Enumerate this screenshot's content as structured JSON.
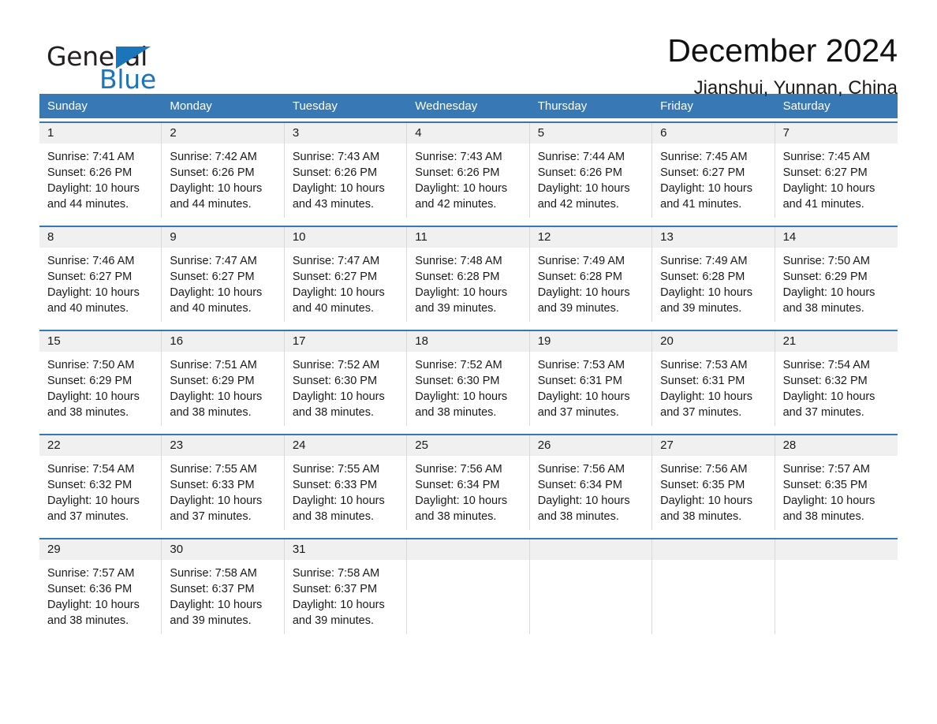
{
  "brand": {
    "word_one": "General",
    "word_two": "Blue",
    "triangle_icon": "triangle-icon",
    "accent_color": "#1b75bb"
  },
  "header": {
    "title": "December 2024",
    "location": "Jianshui, Yunnan, China"
  },
  "calendar": {
    "header_bg": "#3878b4",
    "row_rule_color": "#3878b4",
    "day_number_bg": "#f0f0f0",
    "weekdays": [
      "Sunday",
      "Monday",
      "Tuesday",
      "Wednesday",
      "Thursday",
      "Friday",
      "Saturday"
    ],
    "weeks": [
      [
        {
          "day": "1",
          "sunrise": "Sunrise: 7:41 AM",
          "sunset": "Sunset: 6:26 PM",
          "daylight_line1": "Daylight: 10 hours",
          "daylight_line2": "and 44 minutes."
        },
        {
          "day": "2",
          "sunrise": "Sunrise: 7:42 AM",
          "sunset": "Sunset: 6:26 PM",
          "daylight_line1": "Daylight: 10 hours",
          "daylight_line2": "and 44 minutes."
        },
        {
          "day": "3",
          "sunrise": "Sunrise: 7:43 AM",
          "sunset": "Sunset: 6:26 PM",
          "daylight_line1": "Daylight: 10 hours",
          "daylight_line2": "and 43 minutes."
        },
        {
          "day": "4",
          "sunrise": "Sunrise: 7:43 AM",
          "sunset": "Sunset: 6:26 PM",
          "daylight_line1": "Daylight: 10 hours",
          "daylight_line2": "and 42 minutes."
        },
        {
          "day": "5",
          "sunrise": "Sunrise: 7:44 AM",
          "sunset": "Sunset: 6:26 PM",
          "daylight_line1": "Daylight: 10 hours",
          "daylight_line2": "and 42 minutes."
        },
        {
          "day": "6",
          "sunrise": "Sunrise: 7:45 AM",
          "sunset": "Sunset: 6:27 PM",
          "daylight_line1": "Daylight: 10 hours",
          "daylight_line2": "and 41 minutes."
        },
        {
          "day": "7",
          "sunrise": "Sunrise: 7:45 AM",
          "sunset": "Sunset: 6:27 PM",
          "daylight_line1": "Daylight: 10 hours",
          "daylight_line2": "and 41 minutes."
        }
      ],
      [
        {
          "day": "8",
          "sunrise": "Sunrise: 7:46 AM",
          "sunset": "Sunset: 6:27 PM",
          "daylight_line1": "Daylight: 10 hours",
          "daylight_line2": "and 40 minutes."
        },
        {
          "day": "9",
          "sunrise": "Sunrise: 7:47 AM",
          "sunset": "Sunset: 6:27 PM",
          "daylight_line1": "Daylight: 10 hours",
          "daylight_line2": "and 40 minutes."
        },
        {
          "day": "10",
          "sunrise": "Sunrise: 7:47 AM",
          "sunset": "Sunset: 6:27 PM",
          "daylight_line1": "Daylight: 10 hours",
          "daylight_line2": "and 40 minutes."
        },
        {
          "day": "11",
          "sunrise": "Sunrise: 7:48 AM",
          "sunset": "Sunset: 6:28 PM",
          "daylight_line1": "Daylight: 10 hours",
          "daylight_line2": "and 39 minutes."
        },
        {
          "day": "12",
          "sunrise": "Sunrise: 7:49 AM",
          "sunset": "Sunset: 6:28 PM",
          "daylight_line1": "Daylight: 10 hours",
          "daylight_line2": "and 39 minutes."
        },
        {
          "day": "13",
          "sunrise": "Sunrise: 7:49 AM",
          "sunset": "Sunset: 6:28 PM",
          "daylight_line1": "Daylight: 10 hours",
          "daylight_line2": "and 39 minutes."
        },
        {
          "day": "14",
          "sunrise": "Sunrise: 7:50 AM",
          "sunset": "Sunset: 6:29 PM",
          "daylight_line1": "Daylight: 10 hours",
          "daylight_line2": "and 38 minutes."
        }
      ],
      [
        {
          "day": "15",
          "sunrise": "Sunrise: 7:50 AM",
          "sunset": "Sunset: 6:29 PM",
          "daylight_line1": "Daylight: 10 hours",
          "daylight_line2": "and 38 minutes."
        },
        {
          "day": "16",
          "sunrise": "Sunrise: 7:51 AM",
          "sunset": "Sunset: 6:29 PM",
          "daylight_line1": "Daylight: 10 hours",
          "daylight_line2": "and 38 minutes."
        },
        {
          "day": "17",
          "sunrise": "Sunrise: 7:52 AM",
          "sunset": "Sunset: 6:30 PM",
          "daylight_line1": "Daylight: 10 hours",
          "daylight_line2": "and 38 minutes."
        },
        {
          "day": "18",
          "sunrise": "Sunrise: 7:52 AM",
          "sunset": "Sunset: 6:30 PM",
          "daylight_line1": "Daylight: 10 hours",
          "daylight_line2": "and 38 minutes."
        },
        {
          "day": "19",
          "sunrise": "Sunrise: 7:53 AM",
          "sunset": "Sunset: 6:31 PM",
          "daylight_line1": "Daylight: 10 hours",
          "daylight_line2": "and 37 minutes."
        },
        {
          "day": "20",
          "sunrise": "Sunrise: 7:53 AM",
          "sunset": "Sunset: 6:31 PM",
          "daylight_line1": "Daylight: 10 hours",
          "daylight_line2": "and 37 minutes."
        },
        {
          "day": "21",
          "sunrise": "Sunrise: 7:54 AM",
          "sunset": "Sunset: 6:32 PM",
          "daylight_line1": "Daylight: 10 hours",
          "daylight_line2": "and 37 minutes."
        }
      ],
      [
        {
          "day": "22",
          "sunrise": "Sunrise: 7:54 AM",
          "sunset": "Sunset: 6:32 PM",
          "daylight_line1": "Daylight: 10 hours",
          "daylight_line2": "and 37 minutes."
        },
        {
          "day": "23",
          "sunrise": "Sunrise: 7:55 AM",
          "sunset": "Sunset: 6:33 PM",
          "daylight_line1": "Daylight: 10 hours",
          "daylight_line2": "and 37 minutes."
        },
        {
          "day": "24",
          "sunrise": "Sunrise: 7:55 AM",
          "sunset": "Sunset: 6:33 PM",
          "daylight_line1": "Daylight: 10 hours",
          "daylight_line2": "and 38 minutes."
        },
        {
          "day": "25",
          "sunrise": "Sunrise: 7:56 AM",
          "sunset": "Sunset: 6:34 PM",
          "daylight_line1": "Daylight: 10 hours",
          "daylight_line2": "and 38 minutes."
        },
        {
          "day": "26",
          "sunrise": "Sunrise: 7:56 AM",
          "sunset": "Sunset: 6:34 PM",
          "daylight_line1": "Daylight: 10 hours",
          "daylight_line2": "and 38 minutes."
        },
        {
          "day": "27",
          "sunrise": "Sunrise: 7:56 AM",
          "sunset": "Sunset: 6:35 PM",
          "daylight_line1": "Daylight: 10 hours",
          "daylight_line2": "and 38 minutes."
        },
        {
          "day": "28",
          "sunrise": "Sunrise: 7:57 AM",
          "sunset": "Sunset: 6:35 PM",
          "daylight_line1": "Daylight: 10 hours",
          "daylight_line2": "and 38 minutes."
        }
      ],
      [
        {
          "day": "29",
          "sunrise": "Sunrise: 7:57 AM",
          "sunset": "Sunset: 6:36 PM",
          "daylight_line1": "Daylight: 10 hours",
          "daylight_line2": "and 38 minutes."
        },
        {
          "day": "30",
          "sunrise": "Sunrise: 7:58 AM",
          "sunset": "Sunset: 6:37 PM",
          "daylight_line1": "Daylight: 10 hours",
          "daylight_line2": "and 39 minutes."
        },
        {
          "day": "31",
          "sunrise": "Sunrise: 7:58 AM",
          "sunset": "Sunset: 6:37 PM",
          "daylight_line1": "Daylight: 10 hours",
          "daylight_line2": "and 39 minutes."
        },
        {
          "day": "",
          "sunrise": "",
          "sunset": "",
          "daylight_line1": "",
          "daylight_line2": ""
        },
        {
          "day": "",
          "sunrise": "",
          "sunset": "",
          "daylight_line1": "",
          "daylight_line2": ""
        },
        {
          "day": "",
          "sunrise": "",
          "sunset": "",
          "daylight_line1": "",
          "daylight_line2": ""
        },
        {
          "day": "",
          "sunrise": "",
          "sunset": "",
          "daylight_line1": "",
          "daylight_line2": ""
        }
      ]
    ]
  }
}
